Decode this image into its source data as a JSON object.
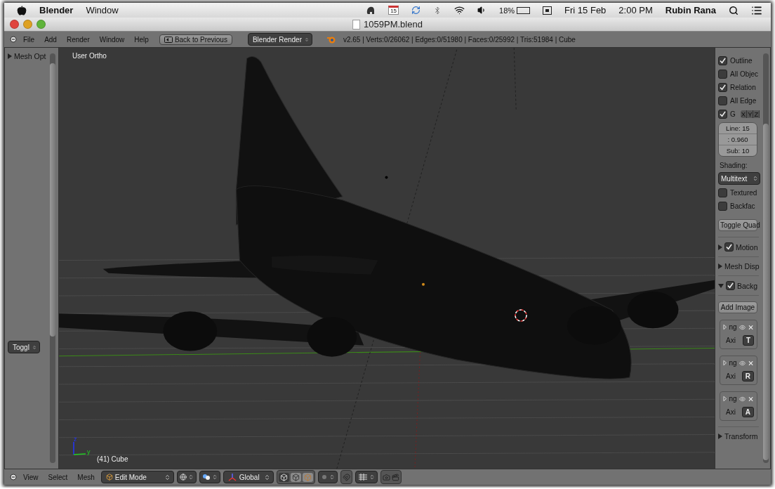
{
  "menubar": {
    "app": "Blender",
    "menus": [
      "Window"
    ],
    "calendar_day": "15",
    "battery": "18%",
    "date": "Fri 15 Feb",
    "time": "2:00 PM",
    "user": "Rubin Rana"
  },
  "window": {
    "title": "1059PM.blend"
  },
  "header": {
    "menus": [
      "File",
      "Add",
      "Render",
      "Window",
      "Help"
    ],
    "back_button": "Back to Previous",
    "engine": "Blender Render",
    "stats": "v2.65 | Verts:0/26062 | Edges:0/51980 | Faces:0/25992 | Tris:51984 | Cube"
  },
  "left_panel": {
    "section": {
      "label": "Mesh Opt",
      "expanded": false
    },
    "dropdown": "Toggl"
  },
  "viewport": {
    "view_label": "User Ortho",
    "object_label": "(41) Cube",
    "axis_z": "z",
    "axis_y": "y"
  },
  "right_panel": {
    "checkboxes": [
      {
        "label": "Outline",
        "checked": true
      },
      {
        "label": "All Objec",
        "checked": false
      },
      {
        "label": "Relation",
        "checked": true
      },
      {
        "label": "All Edge",
        "checked": false
      }
    ],
    "grid": {
      "label": "G",
      "checked": true,
      "axes": [
        "X",
        "Y",
        "Z"
      ]
    },
    "number_fields": [
      "Line: 15",
      ": 0.960",
      "Sub: 10"
    ],
    "shading_label": "Shading:",
    "shading": "Multitext",
    "shading_options": [
      {
        "label": "Textured",
        "checked": false
      },
      {
        "label": "Backfac",
        "checked": false
      }
    ],
    "toggle_button": "Toggle Quad",
    "panels": [
      {
        "label": "Motion",
        "expanded": false,
        "checked": true
      },
      {
        "label": "Mesh Disp",
        "expanded": false
      },
      {
        "label": "Backg",
        "expanded": true,
        "checked": true
      }
    ],
    "add_image": "Add Image",
    "images": [
      {
        "name": "ng",
        "axis_label": "Axi",
        "axis_value": "T"
      },
      {
        "name": "ng",
        "axis_label": "Axi",
        "axis_value": "R"
      },
      {
        "name": "ng",
        "axis_label": "Axi",
        "axis_value": "A"
      }
    ],
    "transform": {
      "label": "Transform",
      "expanded": false
    }
  },
  "bottom_bar": {
    "select_modes": [
      {
        "selected": true
      },
      {
        "selected": false
      },
      {
        "selected": false
      }
    ],
    "menus": [
      "View",
      "Select",
      "Mesh"
    ],
    "mode": "Edit Mode",
    "orientation": "Global"
  }
}
